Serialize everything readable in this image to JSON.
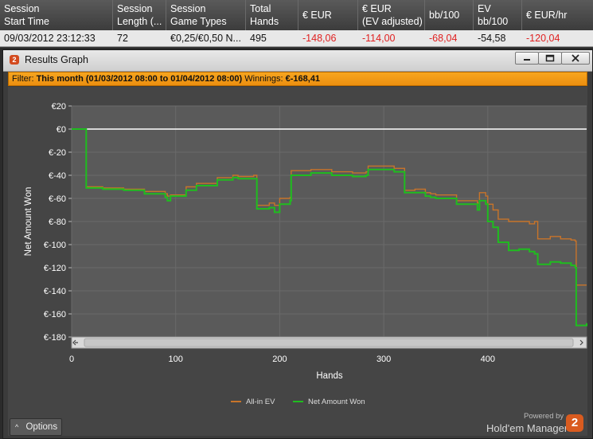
{
  "table": {
    "headers": [
      "Session\nStart Time",
      "Session\nLength (...",
      "Session\nGame Types",
      "Total\nHands",
      "€ EUR",
      "€ EUR\n(EV adjusted)",
      "bb/100",
      "EV\nbb/100",
      "€ EUR/hr"
    ],
    "row": [
      "09/03/2012 23:12:33",
      "72",
      "€0,25/€0,50 N...",
      "495",
      "-148,06",
      "-114,00",
      "-68,04",
      "-54,58",
      "-120,04"
    ]
  },
  "window": {
    "logo": "2",
    "title": "Results Graph",
    "buttons": [
      "minimize-icon",
      "maximize-icon",
      "close-icon"
    ]
  },
  "filter": {
    "label": "Filter:",
    "value": "This month (01/03/2012 08:00 to 01/04/2012 08:00)",
    "winnings_label": "Winnings:",
    "winnings_value": "€-168,41"
  },
  "options": {
    "label": "Options",
    "icon": "chevron-up-icon"
  },
  "branding": {
    "powered": "Powered by",
    "name": "Hold'em Manager",
    "logo": "2"
  },
  "colors": {
    "allin_ev": "#c8742a",
    "net_won": "#1fbd1f",
    "filter_bar": "#f29a16",
    "negative": "#e02020"
  },
  "chart_data": {
    "type": "line",
    "xlabel": "Hands",
    "ylabel": "Net Amount Won",
    "xlim": [
      0,
      495
    ],
    "ylim": [
      -180,
      20
    ],
    "xticks": [
      0,
      100,
      200,
      300,
      400
    ],
    "yticks": [
      20,
      0,
      -20,
      -40,
      -60,
      -80,
      -100,
      -120,
      -140,
      -160,
      -180
    ],
    "ytick_labels": [
      "€20",
      "€0",
      "€-20",
      "€-40",
      "€-60",
      "€-80",
      "€-100",
      "€-120",
      "€-140",
      "€-160",
      "€-180"
    ],
    "grid": true,
    "legend": "bottom-center",
    "series": [
      {
        "name": "All-in EV",
        "x": [
          0,
          10,
          13,
          14,
          30,
          50,
          70,
          90,
          92,
          95,
          110,
          120,
          140,
          155,
          160,
          175,
          178,
          190,
          195,
          200,
          210,
          211,
          230,
          250,
          270,
          283,
          285,
          300,
          310,
          320,
          330,
          340,
          345,
          350,
          370,
          390,
          392,
          398,
          400,
          405,
          410,
          420,
          430,
          440,
          445,
          448,
          460,
          470,
          480,
          484,
          485,
          495
        ],
        "y": [
          0,
          0,
          0,
          -50,
          -51,
          -52,
          -54,
          -56,
          -58,
          -57,
          -50,
          -47,
          -42,
          -40,
          -41,
          -40,
          -66,
          -64,
          -66,
          -60,
          -59,
          -36,
          -35,
          -37,
          -38,
          -37,
          -32,
          -32,
          -34,
          -53,
          -52,
          -55,
          -56,
          -57,
          -62,
          -64,
          -55,
          -58,
          -65,
          -70,
          -78,
          -80,
          -80,
          -82,
          -80,
          -95,
          -93,
          -95,
          -96,
          -97,
          -135,
          -135
        ]
      },
      {
        "name": "Net Amount Won",
        "x": [
          0,
          10,
          13,
          14,
          30,
          50,
          70,
          90,
          92,
          95,
          110,
          120,
          140,
          155,
          160,
          175,
          178,
          190,
          195,
          200,
          210,
          211,
          230,
          250,
          270,
          283,
          285,
          300,
          310,
          320,
          330,
          340,
          345,
          350,
          370,
          390,
          392,
          398,
          400,
          405,
          410,
          420,
          430,
          440,
          445,
          448,
          460,
          470,
          480,
          484,
          485,
          495
        ],
        "y": [
          0,
          0,
          0,
          -51,
          -52,
          -53,
          -56,
          -59,
          -62,
          -58,
          -53,
          -49,
          -44,
          -42,
          -43,
          -43,
          -69,
          -68,
          -72,
          -65,
          -62,
          -40,
          -38,
          -40,
          -41,
          -40,
          -35,
          -35,
          -37,
          -55,
          -55,
          -58,
          -59,
          -60,
          -65,
          -70,
          -62,
          -65,
          -80,
          -85,
          -98,
          -105,
          -104,
          -106,
          -108,
          -117,
          -115,
          -116,
          -118,
          -120,
          -170,
          -168
        ]
      }
    ]
  }
}
